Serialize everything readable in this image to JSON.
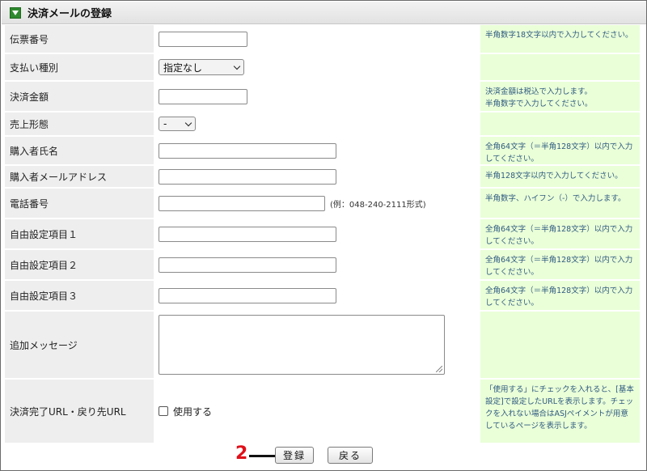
{
  "header": {
    "title": "決済メールの登録"
  },
  "fields": [
    {
      "label": "伝票番号",
      "value": "",
      "note": "半角数字18文字以内で入力してください。"
    },
    {
      "label": "支払い種別",
      "selected": "指定なし",
      "note": ""
    },
    {
      "label": "決済金額",
      "value": "",
      "note": "決済金額は税込で入力します。\n半角数字で入力してください。"
    },
    {
      "label": "売上形態",
      "selected": "-",
      "note": ""
    },
    {
      "label": "購入者氏名",
      "value": "",
      "note": "全角64文字（＝半角128文字）以内で入力してください。"
    },
    {
      "label": "購入者メールアドレス",
      "value": "",
      "note": "半角128文字以内で入力してください。"
    },
    {
      "label": "電話番号",
      "value": "",
      "example": "(例：048-240-2111形式)",
      "note": "半角数字、ハイフン（-）で入力します。"
    },
    {
      "label": "自由設定項目１",
      "value": "",
      "note": "全角64文字（＝半角128文字）以内で入力してください。"
    },
    {
      "label": "自由設定項目２",
      "value": "",
      "note": "全角64文字（＝半角128文字）以内で入力してください。"
    },
    {
      "label": "自由設定項目３",
      "value": "",
      "note": "全角64文字（＝半角128文字）以内で入力してください。"
    },
    {
      "label": "追加メッセージ",
      "value": "",
      "note": ""
    },
    {
      "label": "決済完了URL・戻り先URL",
      "checkbox_label": "使用する",
      "checked": false,
      "note": "「使用する」にチェックを入れると、[基本設定]で設定したURLを表示します。チェックを入れない場合はASJペイメントが用意しているページを表示します。"
    }
  ],
  "buttons": {
    "register": "登録",
    "back": "戻る"
  },
  "annotation": {
    "marker": "2"
  },
  "colors": {
    "label_bg": "#eeeeee",
    "note_bg": "#eaffd8",
    "note_text": "#2f5a80",
    "header_icon": "#2f8a2f",
    "marker": "#e0101a"
  },
  "icons": {
    "header": "triangle-down-icon",
    "select": "chevron-down-icon",
    "textarea": "resize-grip-icon"
  }
}
